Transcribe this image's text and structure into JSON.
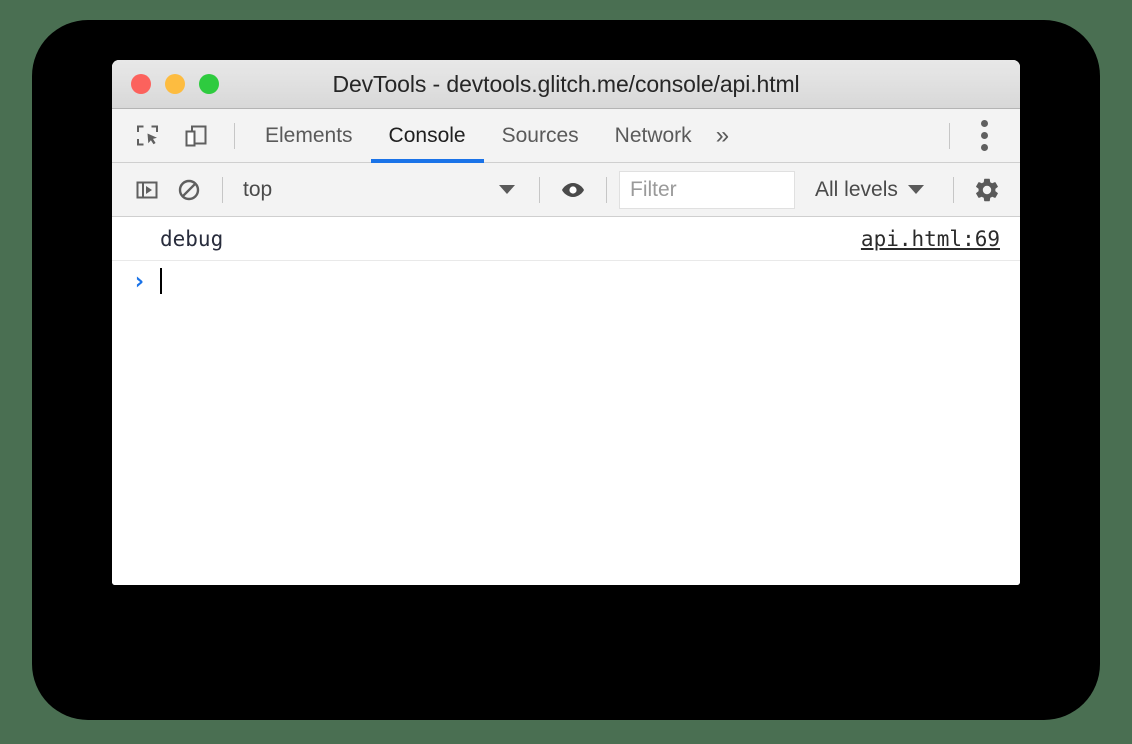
{
  "window": {
    "title": "DevTools - devtools.glitch.me/console/api.html",
    "traffic_lights": [
      {
        "name": "close",
        "color": "#fc625d"
      },
      {
        "name": "minimize",
        "color": "#fdbc40"
      },
      {
        "name": "maximize",
        "color": "#2ecb3f"
      }
    ]
  },
  "toolbar": {
    "inspect_icon": "inspect-element-icon",
    "device_icon": "device-toolbar-icon",
    "overflow_label": "»",
    "menu_icon": "kebab-menu-icon",
    "tabs": [
      {
        "label": "Elements",
        "active": false
      },
      {
        "label": "Console",
        "active": true
      },
      {
        "label": "Sources",
        "active": false
      },
      {
        "label": "Network",
        "active": false
      }
    ],
    "active_tab_color": "#1a73e8"
  },
  "filterbar": {
    "sidebar_icon": "show-console-sidebar-icon",
    "clear_icon": "clear-console-icon",
    "context": {
      "value": "top",
      "caret": "▼"
    },
    "eye_icon": "live-expression-eye-icon",
    "filter": {
      "value": "",
      "placeholder": "Filter"
    },
    "levels": {
      "value": "All levels",
      "caret": "▼"
    },
    "settings_icon": "settings-gear-icon"
  },
  "console": {
    "messages": [
      {
        "text": "debug",
        "source": "api.html:69"
      }
    ],
    "prompt": {
      "chevron": "›",
      "input_value": ""
    }
  }
}
